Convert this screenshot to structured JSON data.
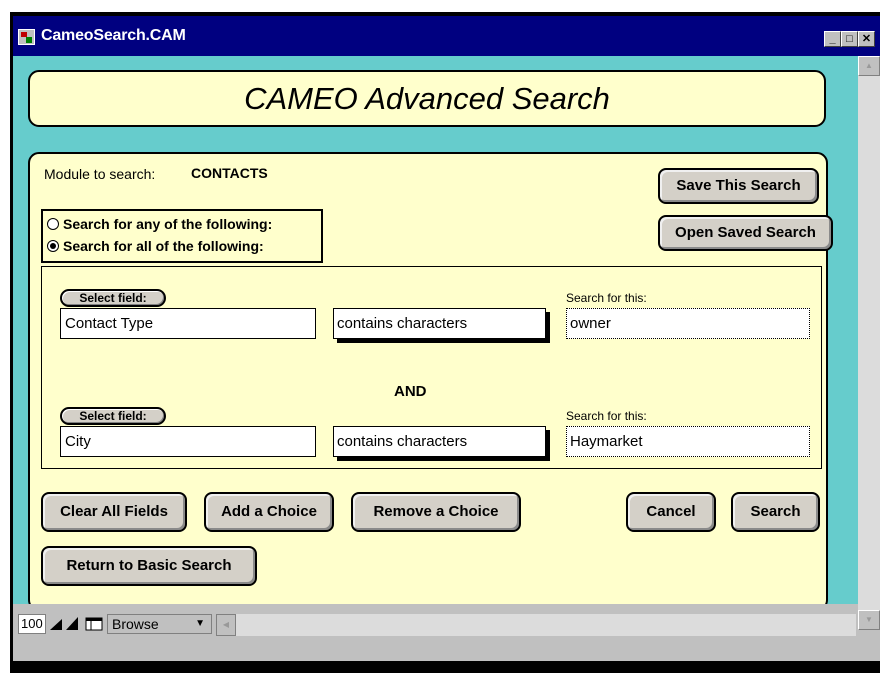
{
  "window": {
    "title": "CameoSearch.CAM",
    "minimize": "_",
    "maximize": "□",
    "close": "✕"
  },
  "header": {
    "title": "CAMEO Advanced Search"
  },
  "module": {
    "label": "Module to search:",
    "value": "CONTACTS"
  },
  "radio": {
    "any_label": "Search for any of the following:",
    "all_label": "Search for all of the following:",
    "selected": "all"
  },
  "actions": {
    "save_search": "Save This Search",
    "open_saved": "Open Saved Search"
  },
  "criteria": [
    {
      "select_label": "Select field:",
      "field": "Contact Type",
      "operator": "contains characters",
      "search_label": "Search for this:",
      "value": "owner"
    },
    {
      "select_label": "Select field:",
      "field": "City",
      "operator": "contains characters",
      "search_label": "Search for this:",
      "value": "Haymarket"
    }
  ],
  "conjunction": "AND",
  "buttons": {
    "clear_all": "Clear All Fields",
    "add_choice": "Add a Choice",
    "remove_choice": "Remove a Choice",
    "cancel": "Cancel",
    "search": "Search",
    "return_basic": "Return to Basic Search"
  },
  "statusbar": {
    "zoom": "100",
    "mode": "Browse"
  }
}
